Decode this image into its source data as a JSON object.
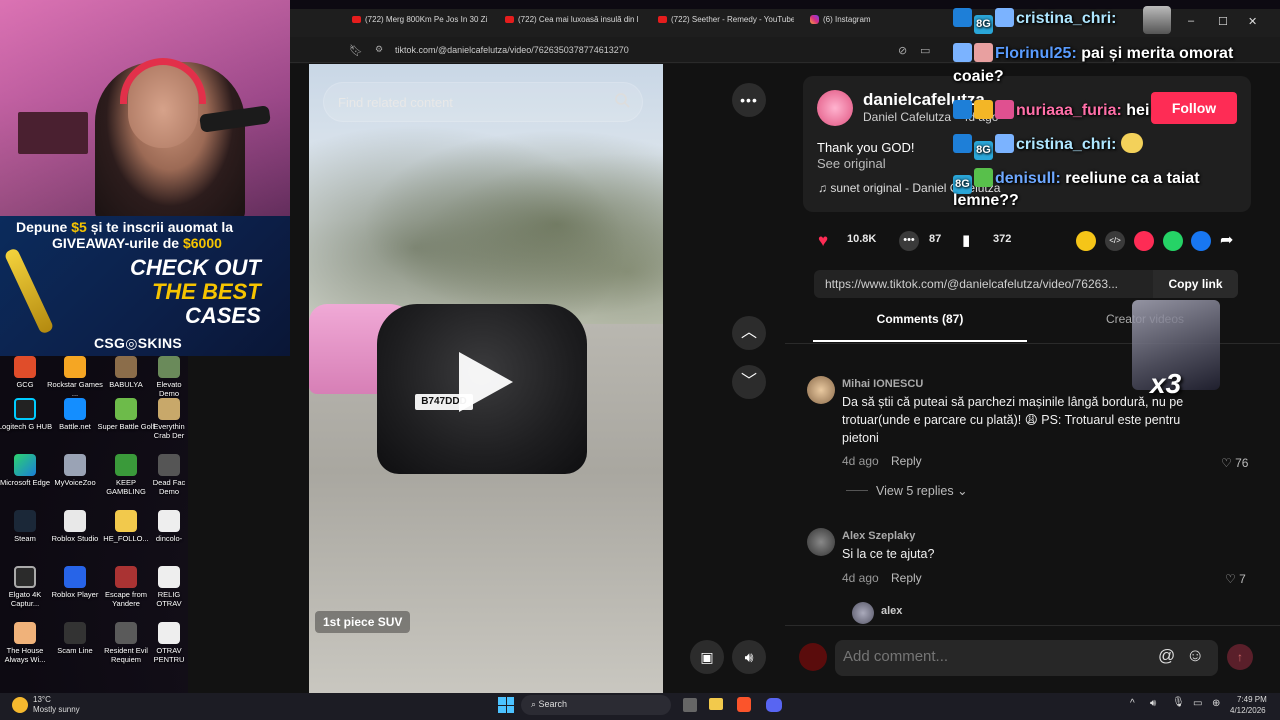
{
  "desktop": {
    "icons": [
      {
        "label": "GCG"
      },
      {
        "label": "Rockstar Games ..."
      },
      {
        "label": "BABULYA"
      },
      {
        "label": "Elevato Demo"
      },
      {
        "label": "Logitech G HUB"
      },
      {
        "label": "Battle.net"
      },
      {
        "label": "Super Battle Golf"
      },
      {
        "label": "Everythin Crab Der"
      },
      {
        "label": "Microsoft Edge"
      },
      {
        "label": "MyVoiceZoo"
      },
      {
        "label": "KEEP GAMBLING"
      },
      {
        "label": "Dead Fac Demo"
      },
      {
        "label": "Steam"
      },
      {
        "label": "Roblox Studio"
      },
      {
        "label": "HE_FOLLO..."
      },
      {
        "label": "dincolo-"
      },
      {
        "label": "Elgato 4K Captur..."
      },
      {
        "label": "Roblox Player"
      },
      {
        "label": "Escape from Yandere"
      },
      {
        "label": "RELIG OTRAV"
      },
      {
        "label": "The House Always Wi..."
      },
      {
        "label": "Scam Line"
      },
      {
        "label": "Resident Evil Requiem"
      },
      {
        "label": "OTRAV PENTRU"
      }
    ]
  },
  "ad": {
    "line1_pre": "Depune ",
    "line1_amount": "$5",
    "line1_post": " și te inscrii auomat la",
    "line2_pre": "GIVEAWAY-urile de ",
    "line2_amount": "$6000",
    "check_out": "CHECK OUT",
    "the_best": "THE BEST",
    "cases": "CASES",
    "brand": "CSG◎SKINS"
  },
  "browser": {
    "tabs": [
      {
        "title": "(722) Merg 800Km Pe Jos In 30 Zi"
      },
      {
        "title": "(722) Cea mai luxoasă insulă din l"
      },
      {
        "title": "(722) Seether - Remedy - YouTube"
      },
      {
        "title": "(6) Instagram"
      }
    ],
    "url": "tiktok.com/@danielcafelutza/video/7626350378774613270"
  },
  "video": {
    "search_placeholder": "Find related content",
    "plate": "B747DDD",
    "caption": "1st piece SUV"
  },
  "post": {
    "username": "danielcafelutza",
    "nickname": "Daniel Cafelutza",
    "nickname_suffix": "· 4d ago",
    "follow_label": "Follow",
    "description": "Thank you GOD!",
    "see_original": "See original",
    "sound": "sunet original - Daniel Cafelutza",
    "likes": "10.8K",
    "comments": "87",
    "saves": "372",
    "link": "https://www.tiktok.com/@danielcafelutza/video/76263...",
    "copy_link": "Copy link"
  },
  "tabs": {
    "comments": "Comments (87)",
    "creator_videos": "Creator videos"
  },
  "comments": [
    {
      "author": "Mihai IONESCU",
      "text": "Da să știi că puteai să parchezi mașinile lângă bordură, nu pe trotuar(unde e parcare cu plată)! 😩 PS: Trotuarul este pentru pietoni",
      "time": "4d ago",
      "reply": "Reply",
      "likes": "76",
      "view_replies": "View 5 replies"
    },
    {
      "author": "Alex Szeplaky",
      "text": "Si la ce te ajuta?",
      "time": "4d ago",
      "reply": "Reply",
      "likes": "7"
    },
    {
      "author": "alex"
    }
  ],
  "comment_input": {
    "placeholder": "Add comment..."
  },
  "chat": [
    {
      "user": "cristina_chri:",
      "message": "",
      "color": "#aee6ff"
    },
    {
      "user": "Florinul25:",
      "message": "pai și merita omorat",
      "color": "#5a9cff"
    },
    {
      "user": "",
      "message": "coaie?",
      "color": "#ffffff"
    },
    {
      "user": "nuriaaa_furia:",
      "message": "hei",
      "color": "#ff6fa8"
    },
    {
      "user": "cristina_chri:",
      "message": "",
      "color": "#aee6ff"
    },
    {
      "user": "denisull:",
      "message": "reeliune ca a taiat",
      "color": "#6ea8ff"
    },
    {
      "user": "",
      "message": "lemne??",
      "color": "#ffffff"
    }
  ],
  "overlay": {
    "multiplier": "x3"
  },
  "taskbar": {
    "weather_temp": "13°C",
    "weather_desc": "Mostly sunny",
    "search": "Search",
    "time": "7:49 PM",
    "date": "4/12/2026"
  },
  "colors": {
    "tiktok_red": "#fe2c55",
    "background": "#121212"
  }
}
